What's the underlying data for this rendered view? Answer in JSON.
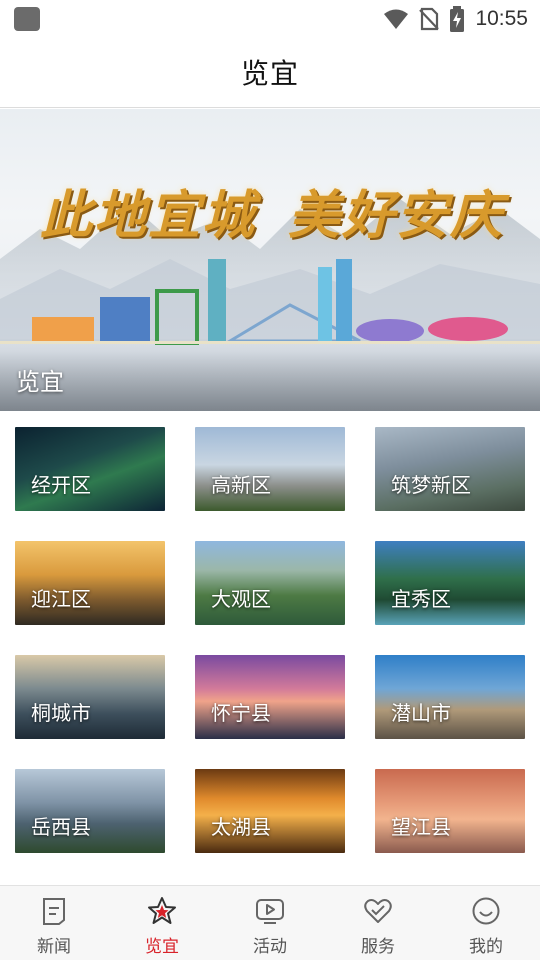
{
  "status_bar": {
    "time": "10:55",
    "icons": [
      "app-icon",
      "wifi-icon",
      "no-sim-icon",
      "battery-charging-icon"
    ]
  },
  "header": {
    "title": "览宜"
  },
  "banner": {
    "slogan_left": "此地宜城",
    "slogan_right": "美好安庆",
    "caption": "览宜"
  },
  "districts": [
    {
      "label": "经开区",
      "theme": "night-park"
    },
    {
      "label": "高新区",
      "theme": "towers"
    },
    {
      "label": "筑梦新区",
      "theme": "campus"
    },
    {
      "label": "迎江区",
      "theme": "sunset-pagoda"
    },
    {
      "label": "大观区",
      "theme": "city-lake"
    },
    {
      "label": "宜秀区",
      "theme": "green-river"
    },
    {
      "label": "桐城市",
      "theme": "misty-hills"
    },
    {
      "label": "怀宁县",
      "theme": "pink-lake"
    },
    {
      "label": "潜山市",
      "theme": "rock-peak"
    },
    {
      "label": "岳西县",
      "theme": "mountains"
    },
    {
      "label": "太湖县",
      "theme": "orange-lake"
    },
    {
      "label": "望江县",
      "theme": "birds-sunset"
    }
  ],
  "tabbar": {
    "active_color": "#d8232a",
    "items": [
      {
        "label": "新闻",
        "icon": "news-icon"
      },
      {
        "label": "览宜",
        "icon": "star-icon"
      },
      {
        "label": "活动",
        "icon": "play-icon"
      },
      {
        "label": "服务",
        "icon": "heart-service-icon"
      },
      {
        "label": "我的",
        "icon": "smile-icon"
      }
    ]
  }
}
